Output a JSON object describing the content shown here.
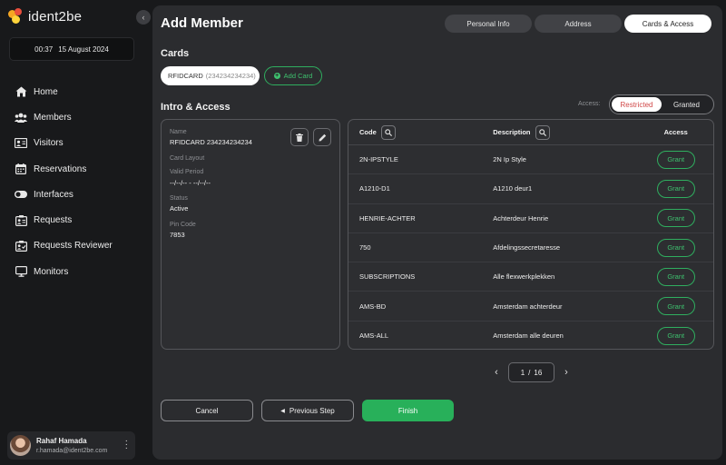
{
  "app": {
    "logo_text": "ident2be"
  },
  "datetime": {
    "time": "00:37",
    "date": "15 August 2024"
  },
  "nav": [
    {
      "label": "Home",
      "icon": "home-icon"
    },
    {
      "label": "Members",
      "icon": "members-icon"
    },
    {
      "label": "Visitors",
      "icon": "visitors-icon"
    },
    {
      "label": "Reservations",
      "icon": "calendar-icon"
    },
    {
      "label": "Interfaces",
      "icon": "toggle-icon"
    },
    {
      "label": "Requests",
      "icon": "requests-icon"
    },
    {
      "label": "Requests Reviewer",
      "icon": "reviewer-icon"
    },
    {
      "label": "Monitors",
      "icon": "monitor-icon"
    }
  ],
  "user": {
    "name": "Rahaf Hamada",
    "email": "r.hamada@ident2be.com"
  },
  "page": {
    "title": "Add Member"
  },
  "tabs": [
    {
      "label": "Personal Info",
      "active": false
    },
    {
      "label": "Address",
      "active": false
    },
    {
      "label": "Cards & Access",
      "active": true
    }
  ],
  "cards": {
    "title": "Cards",
    "chip_name": "RFIDCARD",
    "chip_number": "(234234234234)",
    "add_label": "Add Card"
  },
  "intro": {
    "title": "Intro & Access",
    "access_label": "Access:",
    "toggle": [
      "Restricted",
      "Granted"
    ],
    "toggle_active": "Restricted"
  },
  "detail": {
    "name_label": "Name",
    "name_value": "RFIDCARD 234234234234",
    "layout_label": "Card Layout",
    "period_label": "Valid Period",
    "period_value": "--/--/-- - --/--/--",
    "status_label": "Status",
    "status_value": "Active",
    "pin_label": "Pin Code",
    "pin_value": "7853"
  },
  "table": {
    "headers": {
      "code": "Code",
      "description": "Description",
      "access": "Access"
    },
    "grant_label": "Grant",
    "rows": [
      {
        "code": "2N-IPSTYLE",
        "description": "2N Ip Style"
      },
      {
        "code": "A1210-D1",
        "description": "A1210 deur1"
      },
      {
        "code": "HENRIE-ACHTER",
        "description": "Achterdeur Henrie"
      },
      {
        "code": "750",
        "description": "Afdelingssecretaresse"
      },
      {
        "code": "SUBSCRIPTIONS",
        "description": "Alle flexwerkplekken"
      },
      {
        "code": "AMS-BD",
        "description": "Amsterdam achterdeur"
      },
      {
        "code": "AMS-ALL",
        "description": "Amsterdam alle deuren"
      }
    ]
  },
  "pagination": {
    "current": "1",
    "separator": "/",
    "total": "16"
  },
  "buttons": {
    "cancel": "Cancel",
    "previous": "Previous Step",
    "finish": "Finish"
  },
  "colors": {
    "accent_green": "#28b05a",
    "restricted_red": "#d04848",
    "panel": "#2b2c2f",
    "background": "#18191b"
  }
}
